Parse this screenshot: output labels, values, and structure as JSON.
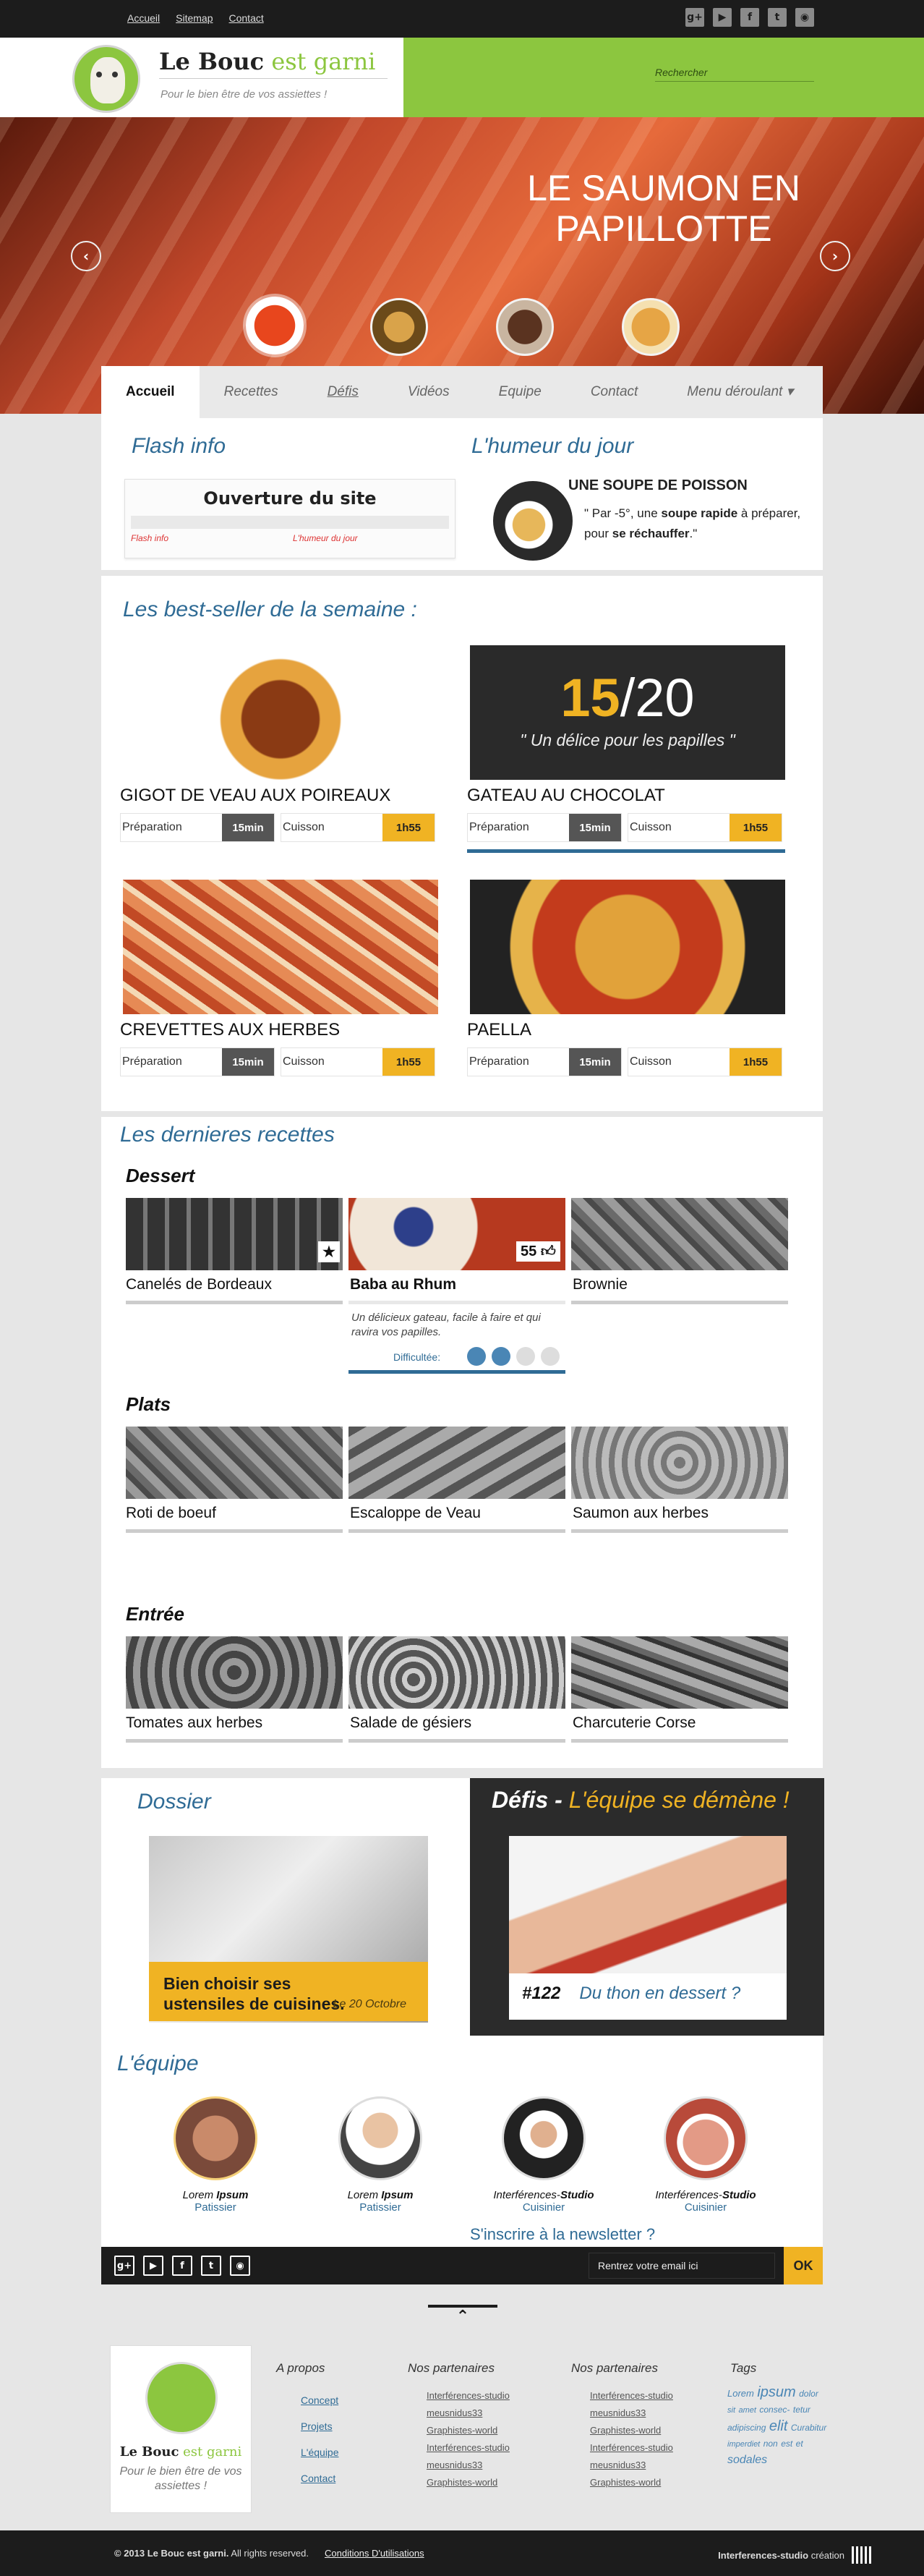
{
  "toplinks": [
    "Accueil",
    "Sitemap",
    "Contact"
  ],
  "social": [
    "g+",
    "yt",
    "f",
    "t",
    "rss"
  ],
  "brand": {
    "name_a": "Le Bouc",
    "name_b": " est garni",
    "tagline": "Pour le bien être de vos assiettes !"
  },
  "search": {
    "placeholder": "Rechercher"
  },
  "hero": {
    "title": "LE SAUMON EN PAPILLOTTE",
    "prev": "‹",
    "next": "›"
  },
  "nav": [
    "Accueil",
    "Recettes",
    "Défis",
    "Vidéos",
    "Equipe",
    "Contact",
    "Menu déroulant ▾"
  ],
  "flash": {
    "heading": "Flash info",
    "box_title": "Ouverture du site",
    "mini_left": "Flash info",
    "mini_right": "L'humeur du jour"
  },
  "humeur": {
    "heading": "L'humeur du jour",
    "title": "UNE SOUPE DE POISSON",
    "text_a": "\" Par -5°, une ",
    "bold_a": "soupe rapide",
    "text_b": " à préparer, pour ",
    "bold_b": "se réchauffer",
    "text_c": ".\""
  },
  "bestseller": {
    "heading": "Les best-seller de la semaine :",
    "items": [
      {
        "name": "GIGOT DE VEAU AUX POIREAUX",
        "prep_label": "Préparation",
        "prep": "15min",
        "cook_label": "Cuisson",
        "cook": "1h55"
      },
      {
        "name": "GATEAU AU CHOCOLAT",
        "prep_label": "Préparation",
        "prep": "15min",
        "cook_label": "Cuisson",
        "cook": "1h55"
      },
      {
        "name": "CREVETTES AUX HERBES",
        "prep_label": "Préparation",
        "prep": "15min",
        "cook_label": "Cuisson",
        "cook": "1h55"
      },
      {
        "name": "PAELLA",
        "prep_label": "Préparation",
        "prep": "15min",
        "cook_label": "Cuisson",
        "cook": "1h55"
      }
    ],
    "score_a": "15",
    "score_b": "/20",
    "score_quote": "\" Un délice pour les papilles \""
  },
  "recettes": {
    "heading": "Les dernieres recettes",
    "cat_dessert": "Dessert",
    "cat_plats": "Plats",
    "cat_entree": "Entrée",
    "dessert": [
      "Canelés de Bordeaux",
      "Baba au Rhum",
      "Brownie"
    ],
    "plats": [
      "Roti de boeuf",
      "Escaloppe de Veau",
      "Saumon aux herbes"
    ],
    "entree": [
      "Tomates aux herbes",
      "Salade de gésiers",
      "Charcuterie Corse"
    ],
    "baba_desc": "Un délicieux gateau, facile à faire et qui ravira vos papilles.",
    "difficulty_label": "Difficultée:",
    "likes": "55",
    "star": "★"
  },
  "dossier": {
    "heading": "Dossier",
    "caption": "Bien choisir ses ustensiles de cuisines.",
    "date": "Le 20 Octobre"
  },
  "defis": {
    "title": "Défis - ",
    "subtitle": "L'équipe se démène !",
    "num": "#122",
    "caption": "Du thon en dessert ?"
  },
  "equipe": {
    "heading": "L'équipe",
    "members": [
      {
        "first": "Lorem ",
        "last": "Ipsum",
        "role": "Patissier"
      },
      {
        "first": "Lorem ",
        "last": "Ipsum",
        "role": "Patissier"
      },
      {
        "first": "Interférences-",
        "last": "Studio",
        "role": "Cuisinier"
      },
      {
        "first": "Interférences-",
        "last": "Studio",
        "role": "Cuisinier"
      }
    ]
  },
  "newsletter": {
    "label": "S'inscrire à la newsletter ?",
    "placeholder": "Rentrez votre email ici",
    "ok": "OK"
  },
  "footer_cols": {
    "apropos": {
      "title": "A propos",
      "links": [
        "Concept",
        "Projets",
        "L'équipe",
        "Contact"
      ]
    },
    "partners1": {
      "title": "Nos partenaires",
      "links": [
        "Interférences-studio",
        "meusnidus33",
        "Graphistes-world",
        "Interférences-studio",
        "meusnidus33",
        "Graphistes-world"
      ]
    },
    "partners2": {
      "title": "Nos partenaires",
      "links": [
        "Interférences-studio",
        "meusnidus33",
        "Graphistes-world",
        "Interférences-studio",
        "meusnidus33",
        "Graphistes-world"
      ]
    },
    "tags": {
      "title": "Tags",
      "words": [
        "Lorem",
        "ipsum",
        "dolor",
        "sit",
        "amet",
        "consec-",
        "tetur",
        "adipiscing",
        "elit",
        "Curabitur",
        "imperdiet",
        "non",
        "est",
        "et",
        "sodales"
      ]
    }
  },
  "footer": {
    "copy": "© 2013 Le Bouc est garni.",
    "rights": "All rights reserved.",
    "conditions": "Conditions D'utilisations",
    "credit_a": "Interferences-studio",
    "credit_b": " création"
  },
  "colors": {
    "green": "#8cc63f",
    "blue": "#2f6b95",
    "gold": "#f0b323",
    "dark": "#1c1c1c"
  }
}
